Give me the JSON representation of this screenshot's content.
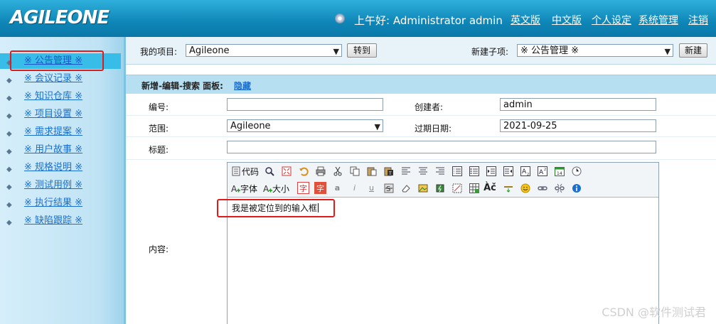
{
  "header": {
    "logo": "AGILEONE",
    "greeting": "上午好: Administrator admin",
    "links": [
      "英文版",
      "中文版",
      "个人设定",
      "系统管理",
      "注销"
    ]
  },
  "sidebar": {
    "items": [
      {
        "label": "※ 公告管理 ※",
        "active": true
      },
      {
        "label": "※ 会议记录 ※"
      },
      {
        "label": "※ 知识仓库 ※"
      },
      {
        "label": "※ 项目设置 ※"
      },
      {
        "label": "※ 需求提案 ※"
      },
      {
        "label": "※ 用户故事 ※"
      },
      {
        "label": "※ 规格说明 ※"
      },
      {
        "label": "※ 测试用例 ※"
      },
      {
        "label": "※ 执行结果 ※"
      },
      {
        "label": "※ 缺陷跟踪 ※"
      }
    ]
  },
  "topbar": {
    "project_label": "我的项目:",
    "project_value": "Agileone",
    "goto_button": "转到",
    "subitem_label": "新建子项:",
    "subitem_value": "※ 公告管理 ※",
    "new_button": "新建"
  },
  "panel": {
    "title": "新增-编辑-搜索 面板:",
    "hide_link": "隐藏"
  },
  "form": {
    "id_label": "编号:",
    "id_value": "",
    "creator_label": "创建者:",
    "creator_value": "admin",
    "scope_label": "范围:",
    "scope_value": "Agileone",
    "expire_label": "过期日期:",
    "expire_value": "2021-09-25",
    "title_label": "标题:",
    "title_value": "",
    "content_label": "内容:"
  },
  "editor": {
    "code_label": "代码",
    "font_label": "字体",
    "size_label": "大小",
    "char_icon": "字",
    "content": "我是被定位到的输入框",
    "calendar_day": "14",
    "accent_sample": "Àč"
  },
  "watermark": "CSDN @软件测试君",
  "colors": {
    "header": "#0e86b7",
    "sidebar_active": "#38bde8",
    "link": "#1a6fd0",
    "highlight": "#e01b1b",
    "panel_head": "#b6dff1"
  }
}
